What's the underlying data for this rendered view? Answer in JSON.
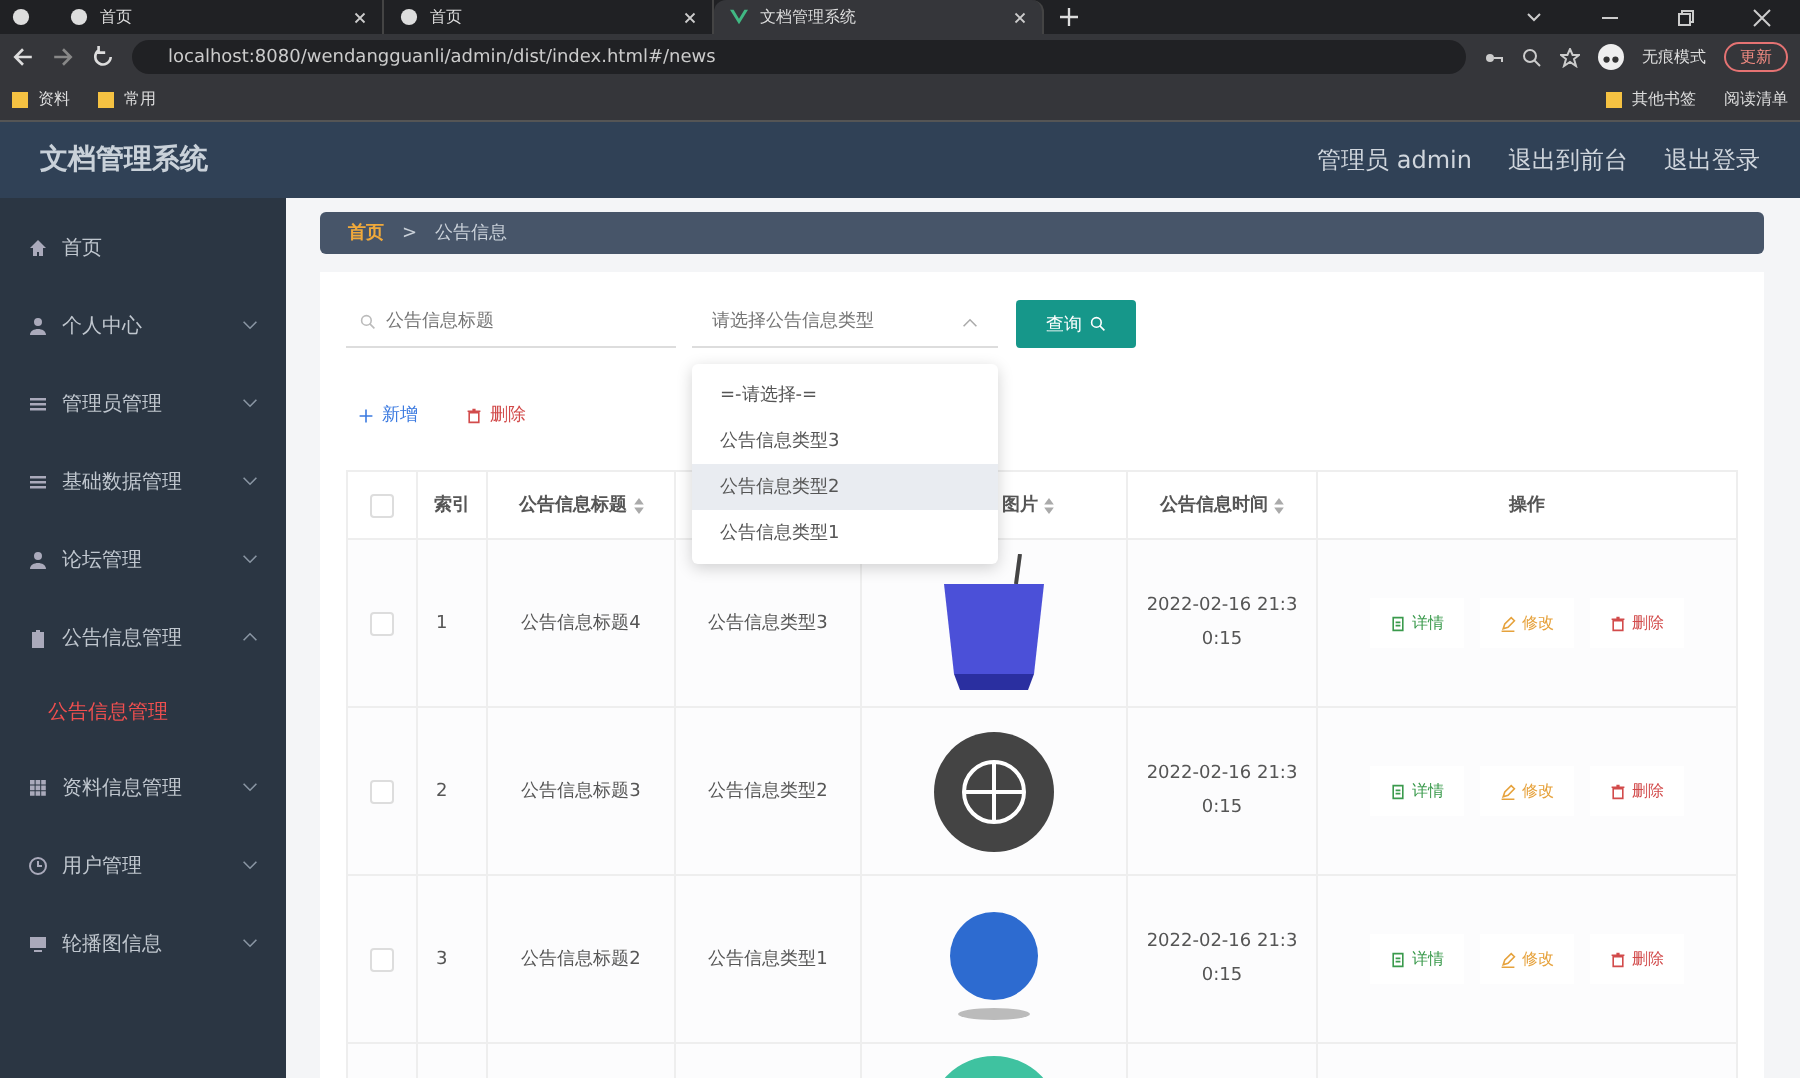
{
  "browser": {
    "tabs": [
      {
        "label": "首页",
        "selected": false
      },
      {
        "label": "首页",
        "selected": false
      },
      {
        "label": "文档管理系统",
        "selected": true
      }
    ],
    "address": "localhost:8080/wendangguanli/admin/dist/index.html#/news",
    "profile": "无痕模式",
    "update_button": "更新",
    "bookmarks_left": [
      "资料",
      "常用"
    ],
    "bookmarks_right": [
      {
        "kind": "folder",
        "label": "其他书签"
      },
      {
        "kind": "list",
        "label": "阅读清单"
      }
    ]
  },
  "header": {
    "title": "文档管理系统",
    "links": [
      "管理员 admin",
      "退出到前台",
      "退出登录"
    ]
  },
  "sidebar": {
    "items": [
      {
        "label": "首页"
      },
      {
        "label": "个人中心",
        "expanded": false
      },
      {
        "label": "管理员管理",
        "expanded": false
      },
      {
        "label": "基础数据管理",
        "expanded": false
      },
      {
        "label": "论坛管理",
        "expanded": false
      },
      {
        "label": "公告信息管理",
        "expanded": true,
        "children": [
          {
            "label": "公告信息管理",
            "selected": true
          }
        ]
      },
      {
        "label": "资料信息管理",
        "expanded": false
      },
      {
        "label": "用户管理",
        "expanded": false
      },
      {
        "label": "轮播图信息",
        "expanded": false
      }
    ]
  },
  "breadcrumb": {
    "home": "首页",
    "separator": ">",
    "current": "公告信息"
  },
  "search": {
    "title_placeholder": "公告信息标题",
    "type_placeholder": "请选择公告信息类型",
    "query_button": "查询"
  },
  "dropdown": {
    "open": true,
    "options": [
      {
        "label": "=-请选择-=",
        "highlighted": false
      },
      {
        "label": "公告信息类型3",
        "highlighted": false
      },
      {
        "label": "公告信息类型2",
        "highlighted": true
      },
      {
        "label": "公告信息类型1",
        "highlighted": false
      }
    ]
  },
  "actions": {
    "add": "新增",
    "delete": "删除"
  },
  "table": {
    "select_all_checked": false,
    "columns": [
      {
        "label": "索引",
        "sortable": false
      },
      {
        "label": "公告信息标题",
        "sortable": true
      },
      {
        "label": "图片",
        "sortable": true
      },
      {
        "label": "公告信息时间",
        "sortable": true
      },
      {
        "label": "操作",
        "sortable": false
      }
    ],
    "rows": [
      {
        "kind": "full",
        "checked": false,
        "index": "1",
        "title": "公告信息标题4",
        "type": "公告信息类型3",
        "time": "2022-02-16 21:30:15",
        "actions": {
          "detail": "详情",
          "edit": "修改",
          "delete": "删除"
        }
      },
      {
        "kind": "full",
        "checked": false,
        "index": "2",
        "title": "公告信息标题3",
        "type": "公告信息类型2",
        "time": "2022-02-16 21:30:15",
        "actions": {
          "detail": "详情",
          "edit": "修改",
          "delete": "删除"
        }
      },
      {
        "kind": "full",
        "checked": false,
        "index": "3",
        "title": "公告信息标题2",
        "type": "公告信息类型1",
        "time": "2022-02-16 21:30:15",
        "actions": {
          "detail": "详情",
          "edit": "修改",
          "delete": "删除"
        }
      },
      {
        "kind": "partial"
      }
    ]
  }
}
